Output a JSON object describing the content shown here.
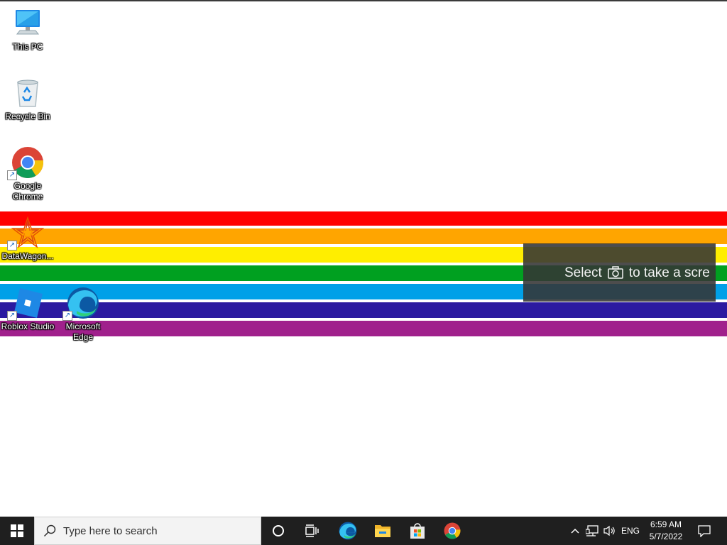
{
  "desktop": {
    "icons": [
      {
        "label": "This PC",
        "icon": "computer-icon"
      },
      {
        "label": "Recycle Bin",
        "icon": "recycle-bin-icon"
      },
      {
        "label": "Google Chrome",
        "icon": "chrome-icon"
      },
      {
        "label": "DataWagon...",
        "icon": "datawagon-icon"
      },
      {
        "label": "Roblox Studio",
        "icon": "roblox-studio-icon"
      },
      {
        "label": "Microsoft Edge",
        "icon": "edge-icon"
      }
    ],
    "wallpaper_stripes": [
      "#ff0000",
      "#ffa500",
      "#ffee00",
      "#00a020",
      "#00a0e8",
      "#2b1aa0",
      "#a0208c"
    ]
  },
  "snip_overlay": {
    "text_before": "Select",
    "text_after": "to take a scre",
    "icon": "camera-icon"
  },
  "taskbar": {
    "search_placeholder": "Type here to search",
    "pinned": [
      "cortana-icon",
      "task-view-icon",
      "edge-icon",
      "file-explorer-icon",
      "microsoft-store-icon",
      "chrome-icon"
    ],
    "language": "ENG",
    "time": "6:59 AM",
    "date": "5/7/2022"
  }
}
